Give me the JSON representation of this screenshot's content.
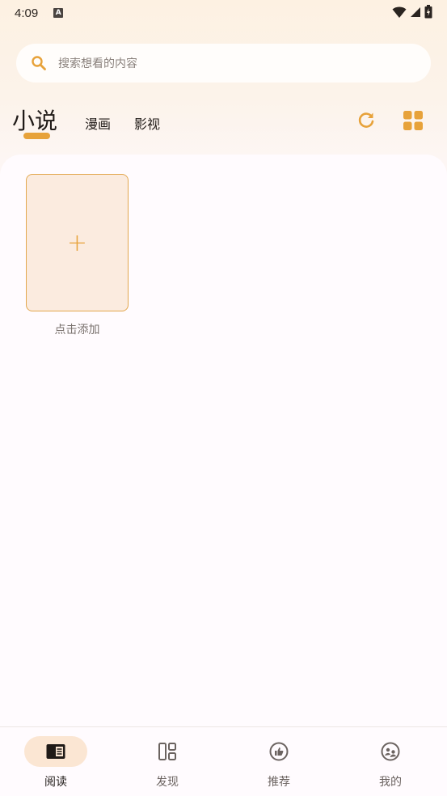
{
  "status_bar": {
    "time": "4:09",
    "a_badge": "A"
  },
  "search": {
    "placeholder": "搜索想看的内容",
    "icon": "search-icon"
  },
  "tabs": {
    "active": "小说",
    "items": [
      "漫画",
      "影视"
    ]
  },
  "toolbar": {
    "refresh_icon": "refresh-icon",
    "layout_icon": "grid-icon"
  },
  "library": {
    "add_label": "点击添加",
    "add_symbol": "+"
  },
  "bottom_nav": [
    {
      "label": "阅读",
      "icon": "book-icon",
      "active": true
    },
    {
      "label": "发现",
      "icon": "dashboard-icon",
      "active": false
    },
    {
      "label": "推荐",
      "icon": "thumbs-up-icon",
      "active": false
    },
    {
      "label": "我的",
      "icon": "profile-icon",
      "active": false
    }
  ],
  "colors": {
    "accent": "#e7a23a",
    "card_bg": "#fbebdf",
    "pill_bg": "#fbe6d3"
  }
}
